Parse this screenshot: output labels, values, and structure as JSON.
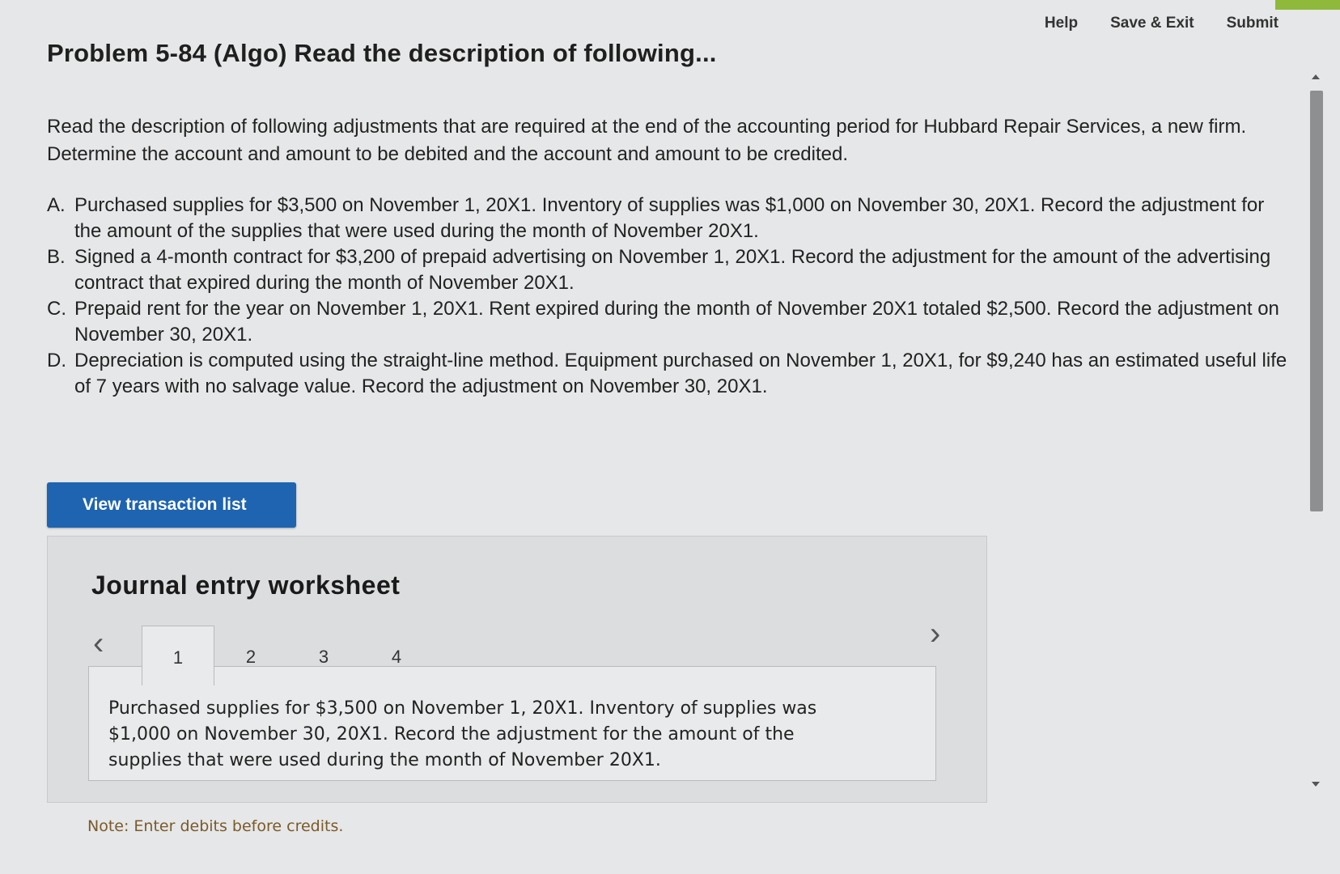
{
  "header": {
    "help_label": "Help",
    "save_exit_label": "Save & Exit",
    "submit_label": "Submit"
  },
  "problem": {
    "title": "Problem 5-84 (Algo) Read the description of following...",
    "intro": "Read the description of following adjustments that are required at the end of the accounting period for Hubbard Repair Services, a new firm. Determine the account and amount to be debited and the account and amount to be credited.",
    "items": [
      {
        "letter": "A.",
        "text": "Purchased supplies for $3,500 on November 1, 20X1. Inventory of supplies was $1,000 on November 30, 20X1. Record the adjustment for the amount of the supplies that were used during the month of November 20X1."
      },
      {
        "letter": "B.",
        "text": "Signed a 4-month contract for $3,200 of prepaid advertising on November 1, 20X1. Record the adjustment for the amount of the advertising contract that expired during the month of November 20X1."
      },
      {
        "letter": "C.",
        "text": "Prepaid rent for the year on November 1, 20X1. Rent expired during the month of November 20X1 totaled $2,500. Record the adjustment on November 30, 20X1."
      },
      {
        "letter": "D.",
        "text": "Depreciation is computed using the straight-line method. Equipment purchased on November 1, 20X1, for $9,240 has an estimated useful life of 7 years with no salvage value. Record the adjustment on November 30, 20X1."
      }
    ]
  },
  "view_transaction_list_label": "View transaction list",
  "worksheet": {
    "title": "Journal entry worksheet",
    "prev_icon": "‹",
    "next_icon": "›",
    "tabs": [
      "1",
      "2",
      "3",
      "4"
    ],
    "active_tab": "1",
    "panel_text": "Purchased supplies for $3,500 on November 1, 20X1. Inventory of supplies was $1,000 on November 30, 20X1. Record the adjustment for the amount of the supplies that were used during the month of November 20X1."
  },
  "note": "Note: Enter debits before credits.",
  "colors": {
    "button_blue": "#1e64b0",
    "accent_green": "#8fb93a"
  }
}
